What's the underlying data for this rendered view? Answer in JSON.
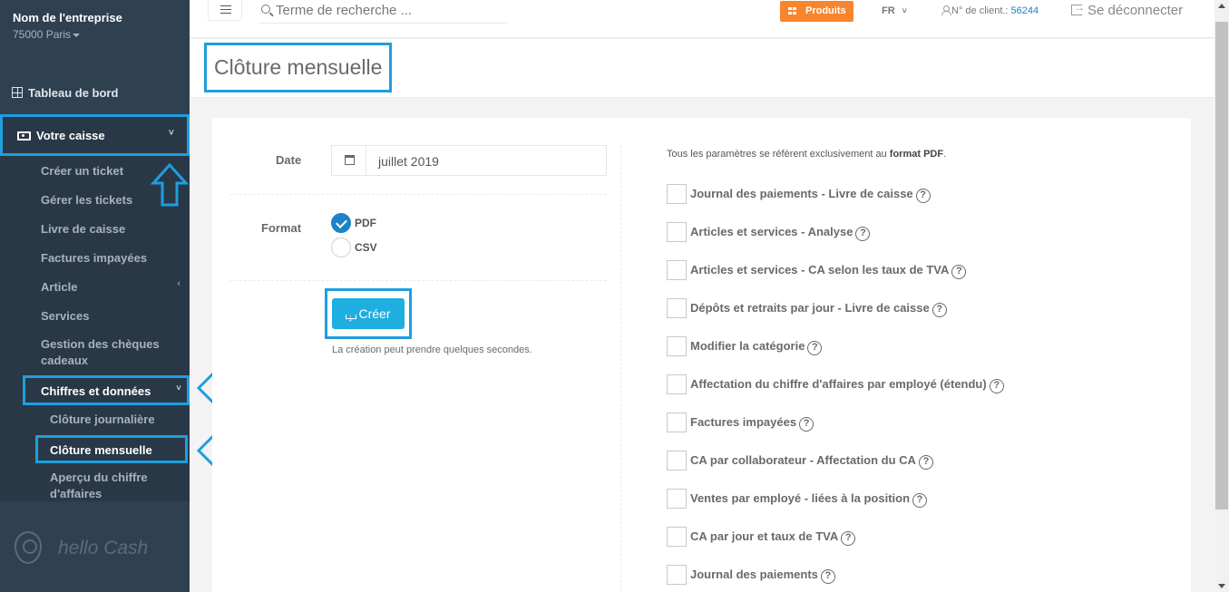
{
  "sidebar": {
    "company_name": "Nom de l'entreprise",
    "company_city": "75000 Paris",
    "dashboard": "Tableau de bord",
    "caisse": "Votre caisse",
    "sub_items": [
      "Créer un ticket",
      "Gérer les tickets",
      "Livre de caisse",
      "Factures impayées",
      "Article",
      "Services",
      "Gestion des chèques cadeaux"
    ],
    "chiffres": "Chiffres et données",
    "chiffres_items": [
      "Clôture journalière",
      "Clôture mensuelle",
      "Aperçu du chiffre d'affaires"
    ],
    "logo_text": "hello Cash"
  },
  "topbar": {
    "search_placeholder": "Terme de recherche ...",
    "produits": "Produits",
    "lang": "FR",
    "client_label": "N° de client.:",
    "client_number": "56244",
    "logout": "Se déconnecter"
  },
  "page": {
    "title": "Clôture mensuelle"
  },
  "form": {
    "date_label": "Date",
    "date_value": "juillet 2019",
    "format_label": "Format",
    "formats": [
      {
        "label": "PDF",
        "selected": true
      },
      {
        "label": "CSV",
        "selected": false
      }
    ],
    "create_button": "Créer",
    "create_note": "La création peut prendre quelques secondes."
  },
  "params": {
    "note_prefix": "Tous les paramètres se réfèrent exclusivement au",
    "note_bold": "format PDF",
    "note_suffix": ".",
    "items": [
      "Journal des paiements - Livre de caisse",
      "Articles et services - Analyse",
      "Articles et services - CA selon les taux de TVA",
      "Dépôts et retraits par jour - Livre de caisse",
      "Modifier la catégorie",
      "Affectation du chiffre d'affaires par employé (étendu)",
      "Factures impayées",
      "CA par collaborateur - Affectation du CA",
      "Ventes par employé - liées à la position",
      "CA par jour et taux de TVA",
      "Journal des paiements"
    ],
    "help_glyph": "?"
  },
  "colors": {
    "sidebar_bg": "#2f4050",
    "highlight": "#1e9ee0",
    "accent_orange": "#f8842c",
    "primary_blue": "#1c84c6"
  }
}
